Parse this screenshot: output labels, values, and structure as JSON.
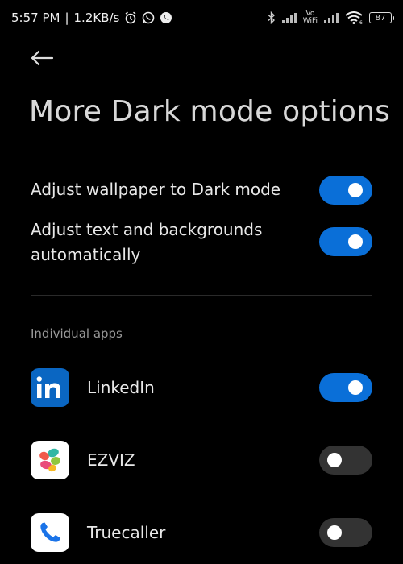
{
  "status_bar": {
    "time": "5:57 PM",
    "separator": "|",
    "speed": "1.2KB/s",
    "icons": [
      "alarm-icon",
      "whatsapp-icon",
      "phone-icon",
      "bluetooth-icon",
      "signal-icon",
      "volte-wifi-icon",
      "wifi-icon"
    ],
    "volte_label": "Vo WiFi",
    "wifi_badge": "6",
    "battery": "87"
  },
  "header": {
    "back_icon": "back-arrow-icon",
    "title": "More Dark mode options"
  },
  "settings": [
    {
      "label": "Adjust wallpaper to Dark mode",
      "enabled": true
    },
    {
      "label": "Adjust text and backgrounds automatically",
      "enabled": true
    }
  ],
  "section": {
    "title": "Individual apps"
  },
  "apps": [
    {
      "name": "LinkedIn",
      "icon": "linkedin-icon",
      "enabled": true
    },
    {
      "name": "EZVIZ",
      "icon": "ezviz-icon",
      "enabled": false
    },
    {
      "name": "Truecaller",
      "icon": "truecaller-icon",
      "enabled": false
    }
  ],
  "colors": {
    "background": "#000000",
    "toggle_on": "#0a6fd8",
    "toggle_off": "#333333",
    "linkedin_blue": "#0a66c2",
    "truecaller_blue": "#1a73e8"
  }
}
